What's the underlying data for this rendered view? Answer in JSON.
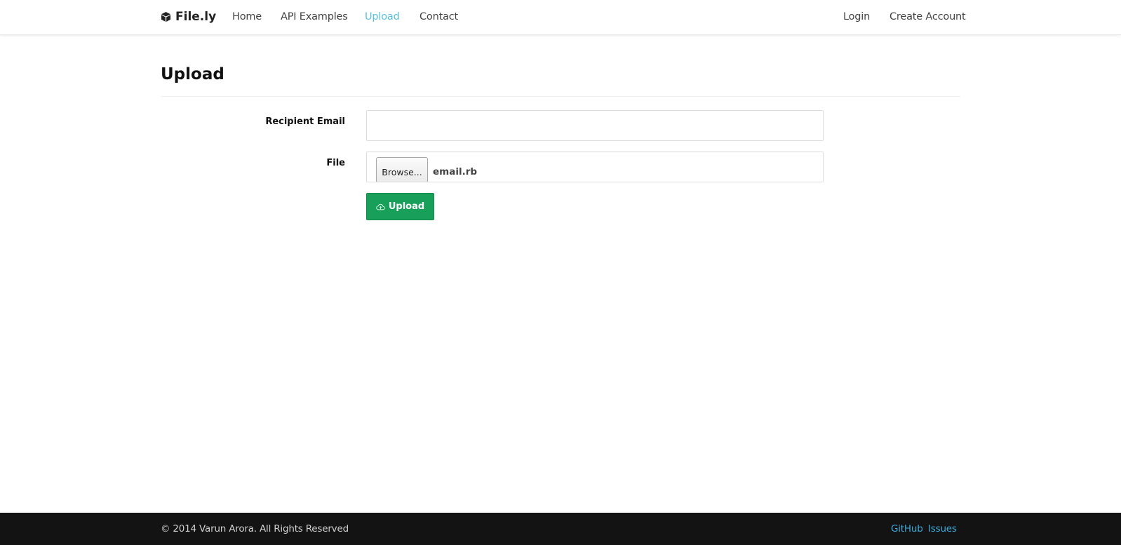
{
  "navbar": {
    "brand": "File.ly",
    "brand_icon": "cube-icon",
    "links": {
      "home": "Home",
      "api_examples": "API Examples",
      "upload": "Upload",
      "contact": "Contact",
      "login": "Login",
      "create_account": "Create Account"
    },
    "active": "upload"
  },
  "page": {
    "title": "Upload"
  },
  "form": {
    "recipient_email_label": "Recipient Email",
    "recipient_email_value": "",
    "file_label": "File",
    "browse_label": "Browse...",
    "file_name": "email.rb",
    "upload_label": "Upload",
    "upload_icon": "cloud-upload-icon"
  },
  "footer": {
    "copyright": "© 2014 Varun Arora. All Rights Reserved",
    "github": "GitHub",
    "issues": "Issues"
  },
  "colors": {
    "accent": "#5bc0de",
    "upload_button": "#18a05a",
    "footer_bg": "#131313",
    "footer_link": "#3fa8d8"
  }
}
